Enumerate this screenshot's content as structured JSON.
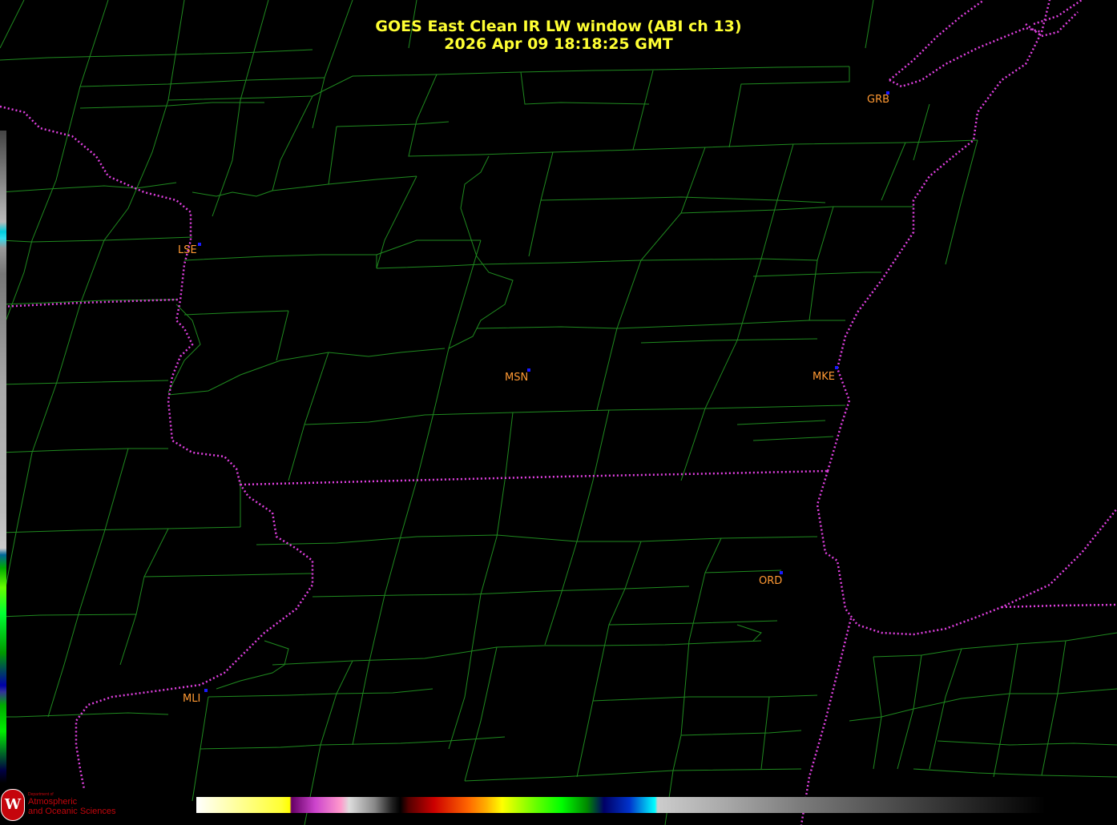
{
  "title": {
    "line1": "GOES East Clean IR LW window (ABI ch 13)",
    "line2": "2026 Apr 09  18:18:25 GMT"
  },
  "cities": [
    {
      "code": "GRB"
    },
    {
      "code": "LSE"
    },
    {
      "code": "MSN"
    },
    {
      "code": "MKE"
    },
    {
      "code": "ORD"
    },
    {
      "code": "MLI"
    }
  ],
  "logo": {
    "letter": "W",
    "dept": "Department of",
    "name_line1": "Atmospheric",
    "name_line2": "and Oceanic Sciences"
  },
  "colors": {
    "county_lines": "#1f8a1f",
    "state_lines": "#e040e0",
    "title": "#ffff33",
    "city_label": "#ff9933",
    "city_dot": "#1a1aff"
  }
}
